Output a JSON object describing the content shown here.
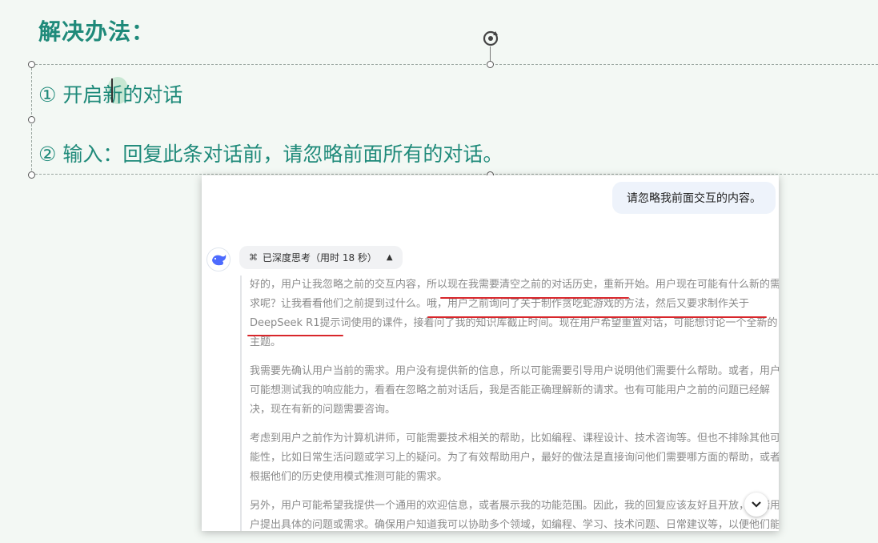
{
  "slide": {
    "title": "解决办法：",
    "step1": "① 开启新的对话",
    "step2": "② 输入：回复此条对话前，请忽略前面所有的对话。"
  },
  "chat": {
    "user_message": "请忽略我前面交互的内容。",
    "thinking_label": "已深度思考（用时 18 秒）",
    "paragraphs": [
      "好的，用户让我忽略之前的交互内容，所以现在我需要清空之前的对话历史，重新开始。用户现在可能有什么新的需求呢？让我看看他们之前提到过什么。哦，用户之前询问了关于制作贪吃蛇游戏的方法，然后又要求制作关于DeepSeek R1提示词使用的课件，接着问了我的知识库截止时间。现在用户希望重置对话，可能想讨论一个全新的主题。",
      "我需要先确认用户当前的需求。用户没有提供新的信息，所以可能需要引导用户说明他们需要什么帮助。或者，用户可能想测试我的响应能力，看看在忽略之前对话后，我是否能正确理解新的请求。也有可能用户之前的问题已经解决，现在有新的问题需要咨询。",
      "考虑到用户之前作为计算机讲师，可能需要技术相关的帮助，比如编程、课程设计、技术咨询等。但也不排除其他可能性，比如日常生活问题或学习上的疑问。为了有效帮助用户，最好的做法是直接询问他们需要哪方面的帮助，或者根据他们的历史使用模式推测可能的需求。",
      "另外，用户可能希望我提供一个通用的欢迎信息，或者展示我的功能范围。因此，我的回复应该友好且开放，邀请用户提出具体的问题或需求。确保用户知道我可以协助多个领域，如编程、学习、技术问题、日常建议等，以便他们能更清晰地表达需求。"
    ]
  },
  "icons": {
    "rotate": "rotate-handle-icon",
    "logo": "deepseek-whale-icon",
    "think": "deep-think-icon",
    "collapse": "chevron-up-icon",
    "scroll": "chevron-down-icon"
  },
  "colors": {
    "accent": "#1f8a7a",
    "annotation": "#d8262b"
  }
}
